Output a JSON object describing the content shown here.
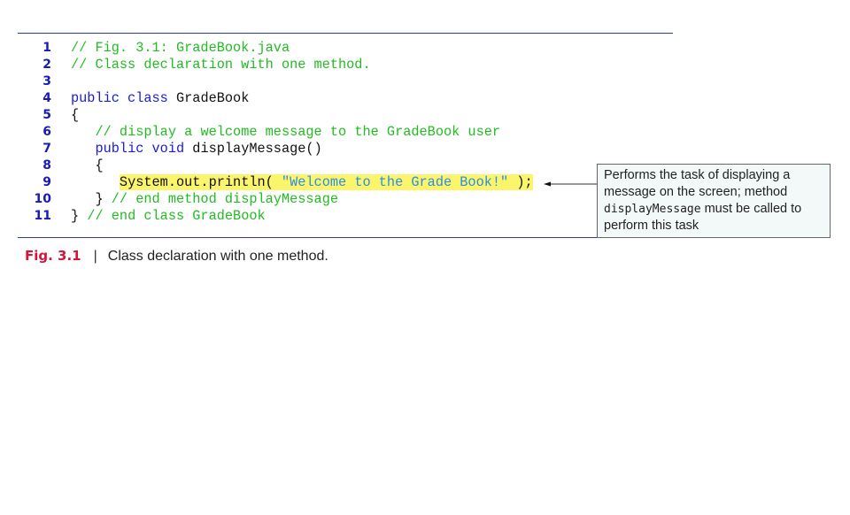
{
  "code_lines": [
    {
      "num": "1",
      "segments": [
        {
          "t": "// Fig. 3.1: GradeBook.java",
          "c": "cm"
        }
      ]
    },
    {
      "num": "2",
      "segments": [
        {
          "t": "// Class declaration with one method.",
          "c": "cm"
        }
      ]
    },
    {
      "num": "3",
      "segments": []
    },
    {
      "num": "4",
      "segments": [
        {
          "t": "public class ",
          "c": "kw"
        },
        {
          "t": "GradeBook",
          "c": "pl"
        }
      ]
    },
    {
      "num": "5",
      "segments": [
        {
          "t": "{",
          "c": "pl"
        }
      ]
    },
    {
      "num": "6",
      "segments": [
        {
          "t": "   ",
          "c": "pl"
        },
        {
          "t": "// display a welcome message to the GradeBook user",
          "c": "cm"
        }
      ]
    },
    {
      "num": "7",
      "segments": [
        {
          "t": "   ",
          "c": "pl"
        },
        {
          "t": "public void ",
          "c": "kw"
        },
        {
          "t": "displayMessage()",
          "c": "pl"
        }
      ]
    },
    {
      "num": "8",
      "segments": [
        {
          "t": "   {",
          "c": "pl"
        }
      ]
    },
    {
      "num": "9",
      "highlight": true,
      "segments": [
        {
          "t": "System.out.println( ",
          "c": "pl"
        },
        {
          "t": "\"Welcome to the Grade Book!\"",
          "c": "st"
        },
        {
          "t": " );",
          "c": "pl"
        }
      ],
      "indent": "      "
    },
    {
      "num": "10",
      "segments": [
        {
          "t": "   } ",
          "c": "pl"
        },
        {
          "t": "// end method displayMessage",
          "c": "cm"
        }
      ]
    },
    {
      "num": "11",
      "segments": [
        {
          "t": "} ",
          "c": "pl"
        },
        {
          "t": "// end class GradeBook",
          "c": "cm"
        }
      ]
    }
  ],
  "callout": {
    "text_before": "Performs the task of displaying a message on the screen; method ",
    "code": "displayMessage",
    "text_after": " must be called to perform this task"
  },
  "caption": {
    "label": "Fig. 3.1",
    "separator": "|",
    "text": "Class declaration with one method."
  },
  "colors": {
    "keyword": "#1a1adc",
    "comment": "#22bb22",
    "string": "#2a8ce8",
    "highlight": "#fbf56c",
    "figure_label": "#d4143a"
  }
}
